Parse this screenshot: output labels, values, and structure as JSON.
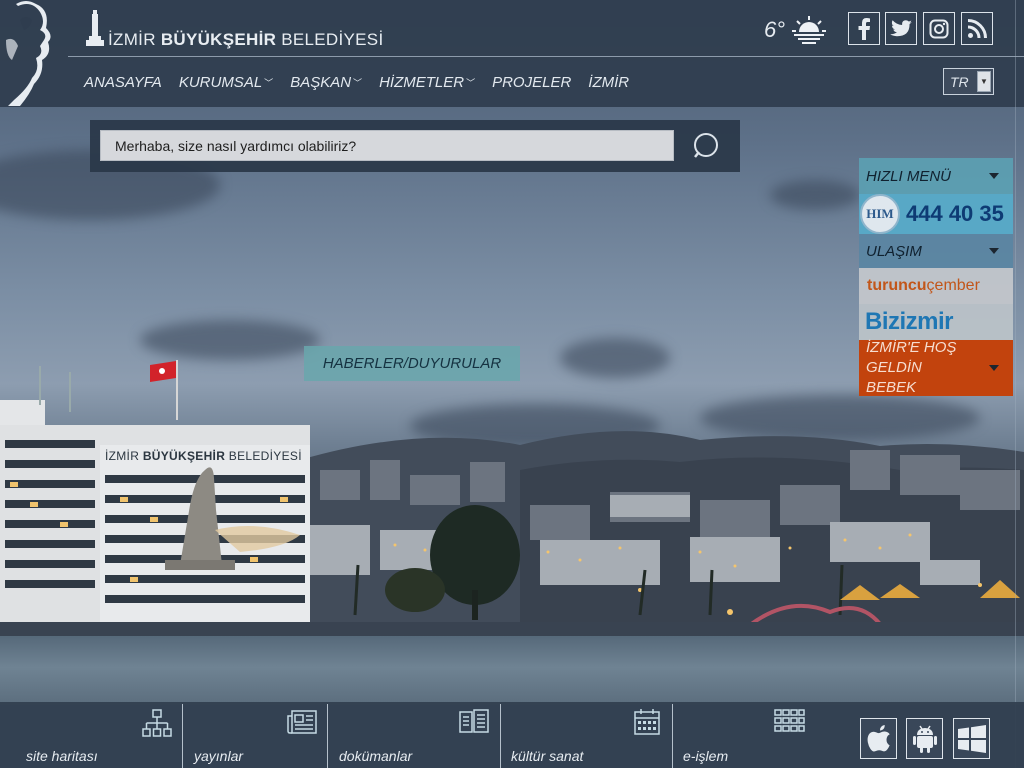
{
  "header": {
    "logo_text_light": "İZMİR",
    "logo_text_bold": "BÜYÜKŞEHİR",
    "logo_text_tail": "BELEDİYESİ",
    "weather_temp": "6°",
    "weather_icon": "sunset-icon",
    "social": [
      "facebook-icon",
      "twitter-icon",
      "instagram-icon",
      "rss-icon"
    ]
  },
  "nav": {
    "items": [
      {
        "label": "ANASAYFA",
        "dropdown": false
      },
      {
        "label": "KURUMSAL",
        "dropdown": true
      },
      {
        "label": "BAŞKAN",
        "dropdown": true
      },
      {
        "label": "HİZMETLER",
        "dropdown": true
      },
      {
        "label": "PROJELER",
        "dropdown": false
      },
      {
        "label": "İZMİR",
        "dropdown": false
      }
    ]
  },
  "lang": {
    "selected": "TR"
  },
  "search": {
    "placeholder": "Merhaba, size nasıl yardımcı olabiliriz?"
  },
  "side_menu": {
    "quick_menu": "HIZLI MENÜ",
    "him_badge": "HIM",
    "phone": "444 40 35",
    "transport": "ULAŞIM",
    "turuncu_a": "turuncu",
    "turuncu_b": "çember",
    "bizizmir": "Bizizmir",
    "welcome": "İZMİR'E HOŞ GELDİN BEBEK"
  },
  "news_tab": "HABERLER/DUYURULAR",
  "scene": {
    "building_sign_light": "İZMİR",
    "building_sign_bold": "BÜYÜKŞEHİR",
    "building_sign_tail": "BELEDİYESİ"
  },
  "bottom": {
    "items": [
      {
        "label": "site haritası",
        "icon": "sitemap-icon"
      },
      {
        "label": "yayınlar",
        "icon": "newspaper-icon"
      },
      {
        "label": "dokümanlar",
        "icon": "documents-icon"
      },
      {
        "label": "kültür sanat",
        "icon": "calendar-icon"
      },
      {
        "label": "e-işlem",
        "icon": "grid-icon"
      }
    ],
    "apps": [
      "apple-icon",
      "android-icon",
      "windows-icon"
    ]
  },
  "colors": {
    "header_bg": "#2f3d4f",
    "quick_menu_bg": "#5ba2b4",
    "phone_bg": "#58a8c6",
    "transport_bg": "#5a86a3",
    "turuncu_bg": "#c4c8cc",
    "bizizmir_bg": "#bcc3c9",
    "welcome_bg": "#c2430d",
    "news_tab_bg": "#69a6ac",
    "flag_red": "#d2232a"
  }
}
